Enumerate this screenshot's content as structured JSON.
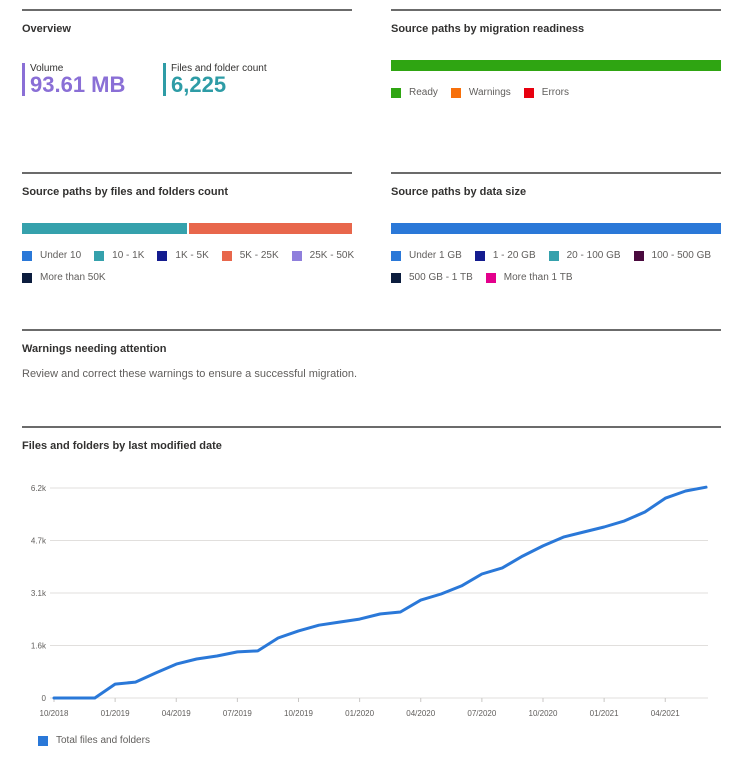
{
  "overview": {
    "title": "Overview",
    "metrics": [
      {
        "label": "Volume",
        "value": "93.61 MB",
        "color": "#8a6fd6"
      },
      {
        "label": "Files and folder count",
        "value": "6,225",
        "color": "#2e9ca6"
      }
    ]
  },
  "readiness": {
    "title": "Source paths by migration readiness",
    "segments": [
      {
        "name": "Ready",
        "share": 1.0,
        "color": "#2fa512"
      }
    ],
    "legend": [
      {
        "label": "Ready",
        "color": "#2fa512"
      },
      {
        "label": "Warnings",
        "color": "#f7700b"
      },
      {
        "label": "Errors",
        "color": "#e8000f"
      }
    ]
  },
  "files_count": {
    "title": "Source paths by files and folders count",
    "segments": [
      {
        "name": "10 - 1K",
        "share": 0.5,
        "color": "#35a1ac"
      },
      {
        "name": "5K - 25K",
        "share": 0.5,
        "color": "#e8674c"
      }
    ],
    "legend_rows": [
      [
        {
          "label": "Under 10",
          "color": "#2a78d8"
        },
        {
          "label": "10 - 1K",
          "color": "#35a1ac"
        },
        {
          "label": "1K - 5K",
          "color": "#141c8f"
        },
        {
          "label": "5K - 25K",
          "color": "#e8674c"
        },
        {
          "label": "25K - 50K",
          "color": "#8f7fdc"
        }
      ],
      [
        {
          "label": "More than 50K",
          "color": "#0c1d3e"
        }
      ]
    ]
  },
  "data_size": {
    "title": "Source paths by data size",
    "segments": [
      {
        "name": "Under 1 GB",
        "share": 1.0,
        "color": "#2a78d8"
      }
    ],
    "legend_rows": [
      [
        {
          "label": "Under 1 GB",
          "color": "#2a78d8"
        },
        {
          "label": "1 - 20 GB",
          "color": "#141c8f"
        },
        {
          "label": "20 - 100 GB",
          "color": "#35a1ac"
        },
        {
          "label": "100 - 500 GB",
          "color": "#4a0a3e"
        }
      ],
      [
        {
          "label": "500 GB - 1 TB",
          "color": "#0c1d3e"
        },
        {
          "label": "More than 1 TB",
          "color": "#e3008c"
        }
      ]
    ]
  },
  "warnings": {
    "title": "Warnings needing attention",
    "description": "Review and correct these warnings to ensure a successful migration."
  },
  "modified": {
    "title": "Files and folders by last modified date"
  },
  "chart_data": {
    "type": "line",
    "title": "Files and folders by last modified date",
    "xlabel": "",
    "ylabel": "",
    "x": [
      "10/2018",
      "11/2018",
      "12/2018",
      "01/2019",
      "02/2019",
      "03/2019",
      "04/2019",
      "05/2019",
      "06/2019",
      "07/2019",
      "08/2019",
      "09/2019",
      "10/2019",
      "11/2019",
      "12/2019",
      "01/2020",
      "02/2020",
      "03/2020",
      "04/2020",
      "05/2020",
      "06/2020",
      "07/2020",
      "08/2020",
      "09/2020",
      "10/2020",
      "11/2020",
      "12/2020",
      "01/2021",
      "02/2021",
      "03/2021",
      "04/2021",
      "05/2021",
      "06/2021"
    ],
    "series": [
      {
        "name": "Total files and folders",
        "color": "#2a78d8",
        "values": [
          0,
          0,
          0,
          410,
          470,
          740,
          1000,
          1150,
          1240,
          1360,
          1390,
          1770,
          1980,
          2150,
          2240,
          2330,
          2480,
          2540,
          2890,
          3070,
          3310,
          3660,
          3840,
          4190,
          4490,
          4750,
          4900,
          5050,
          5230,
          5490,
          5900,
          6110,
          6225
        ]
      }
    ],
    "x_tick_labels": [
      "10/2018",
      "01/2019",
      "04/2019",
      "07/2019",
      "10/2019",
      "01/2020",
      "04/2020",
      "07/2020",
      "10/2020",
      "01/2021",
      "04/2021"
    ],
    "y_ticks": [
      0,
      1550,
      3100,
      4650,
      6200
    ],
    "y_tick_labels": [
      "0",
      "1.6k",
      "3.1k",
      "4.7k",
      "6.2k"
    ],
    "ylim": [
      0,
      6200
    ],
    "grid": true,
    "legend_position": "bottom-left"
  }
}
